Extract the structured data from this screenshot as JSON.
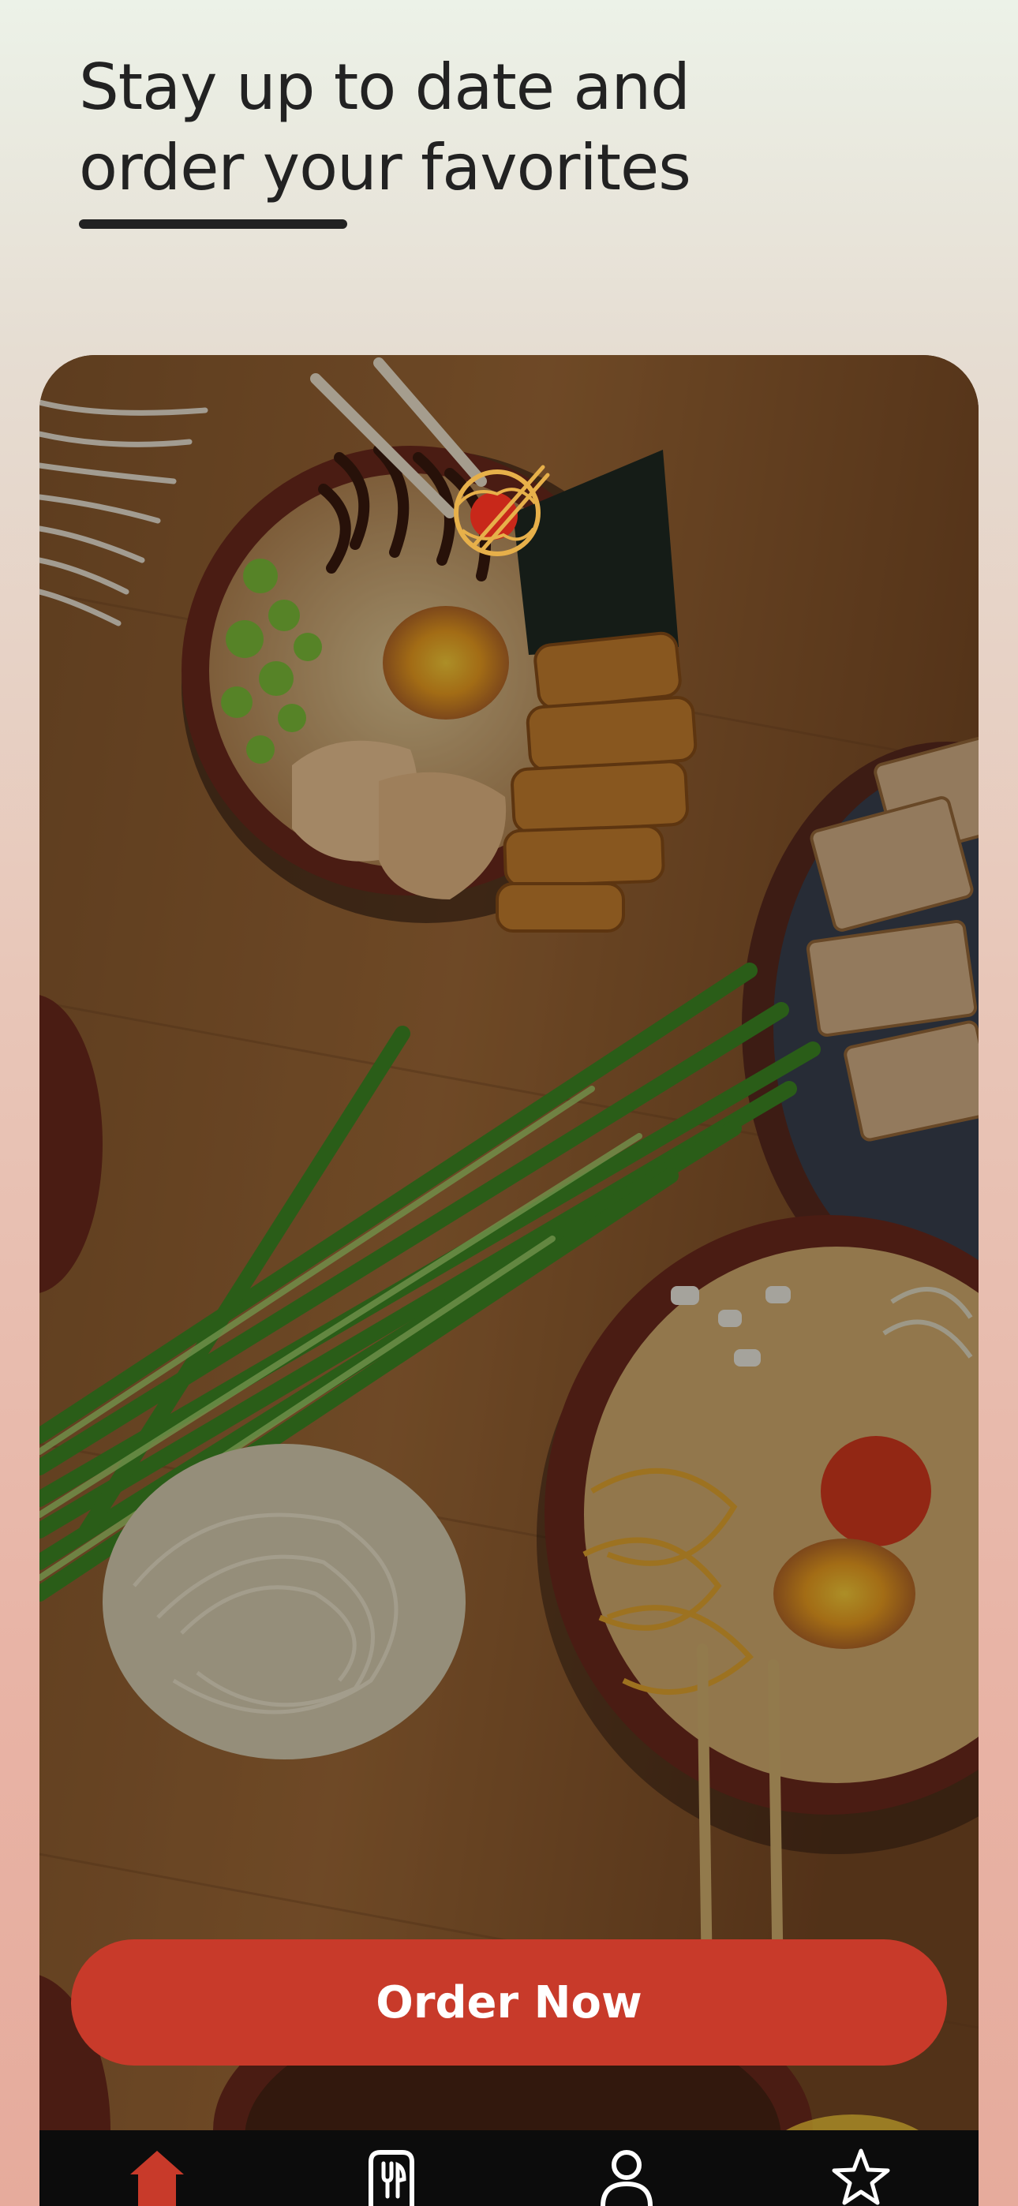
{
  "header": {
    "line1": "Stay up to date and",
    "line2": "order your favorites"
  },
  "hero": {
    "image_description_icon": "ramen-table-photo",
    "logo_icon": "dragon-chopsticks-logo-icon"
  },
  "cta": {
    "label": "Order Now"
  },
  "tabbar": {
    "items": [
      {
        "icon": "home-icon",
        "active": true
      },
      {
        "icon": "restaurant-menu-icon",
        "active": false
      },
      {
        "icon": "profile-icon",
        "active": false
      },
      {
        "icon": "star-icon",
        "active": false
      }
    ]
  },
  "colors": {
    "accent": "#c83a2a",
    "headline": "#222222",
    "tabbar_bg": "#0c0c0c",
    "tab_active": "#c83a2a",
    "tab_inactive": "#ffffff"
  }
}
